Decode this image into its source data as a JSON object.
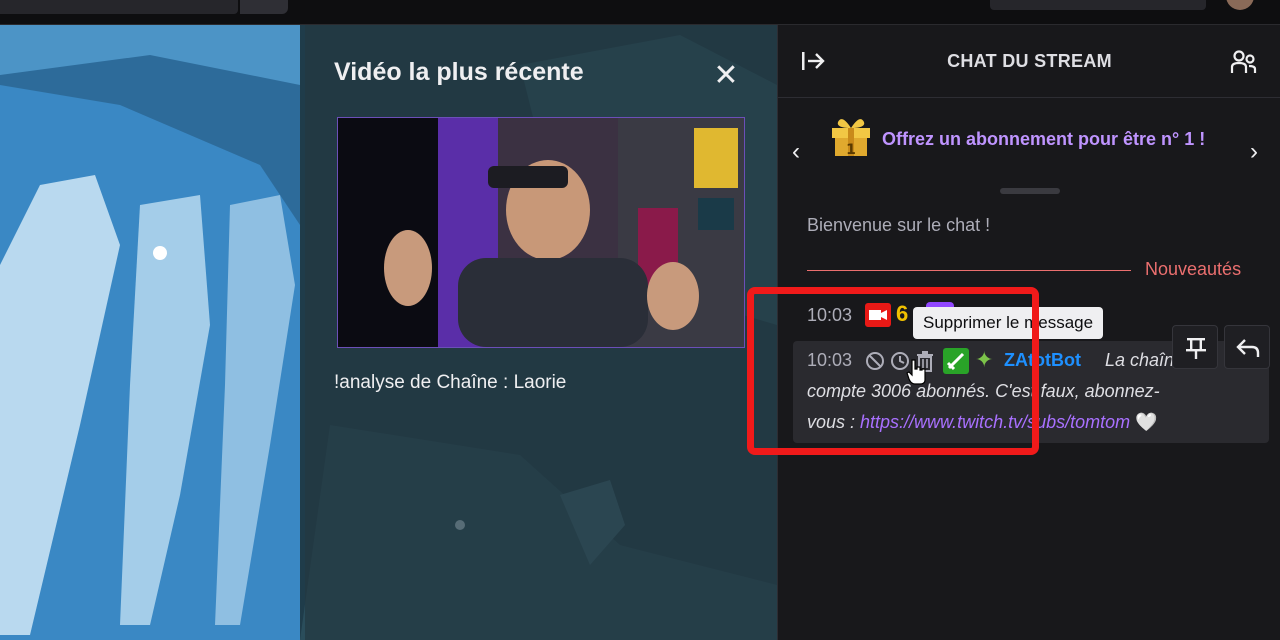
{
  "panel": {
    "title": "Vidéo la plus récente",
    "video_caption": "!analyse de Chaîne : Laorie"
  },
  "chat": {
    "header_title": "CHAT DU STREAM",
    "gift_banner_text": "Offrez un abonnement pour être n° 1 !",
    "gift_rank": "1",
    "welcome": "Bienvenue sur le chat !",
    "news_label": "Nouveautés",
    "messages": [
      {
        "time": "10:03",
        "badge_text": "6"
      },
      {
        "time": "10:03",
        "user": "ZAtotBot",
        "line1": "La chaîne",
        "line2": "compte 3006 abonnés. C'est faux, abonnez-",
        "line3_prefix": "vous : ",
        "link": "https://www.twitch.tv/subs/tomtom",
        "heart": "🤍"
      }
    ],
    "tooltip": "Supprimer le message"
  },
  "icons": {
    "close": "close-icon",
    "collapse": "collapse-chat-icon",
    "users": "community-icon",
    "gift": "gift-icon",
    "ban": "ban-icon",
    "timeout": "timeout-icon",
    "delete": "trash-icon",
    "pin": "pin-icon",
    "reply": "reply-icon"
  },
  "colors": {
    "accent": "#bf94ff",
    "link": "#a970ff",
    "news": "#eb6f6f",
    "highlight": "#f01a1a",
    "username": "#1e90ff"
  }
}
